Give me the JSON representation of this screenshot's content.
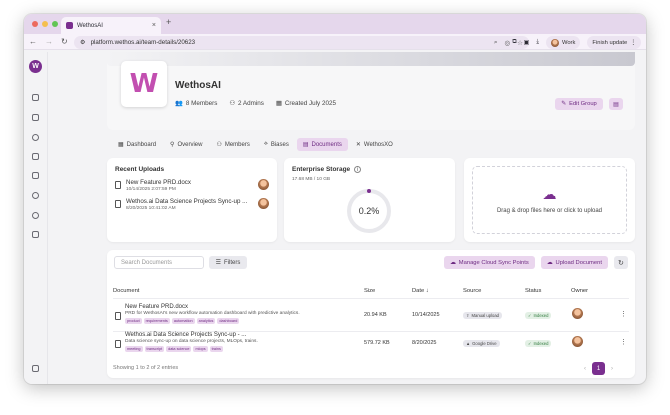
{
  "browser": {
    "tab_title": "WethosAI",
    "tab_close": "×",
    "new_tab": "+",
    "url": "platform.wethos.ai/team-details/20623",
    "profile_label": "Work",
    "update_label": "Finish update"
  },
  "org": {
    "name": "WethosAI",
    "members": "8 Members",
    "admins": "2 Admins",
    "created": "Created July 2025",
    "edit_label": "Edit Group",
    "logo_letter": "W"
  },
  "tabs": [
    {
      "label": "Dashboard"
    },
    {
      "label": "Overview"
    },
    {
      "label": "Members"
    },
    {
      "label": "Biases"
    },
    {
      "label": "Documents"
    },
    {
      "label": "WethosXO"
    }
  ],
  "recent_uploads": {
    "title": "Recent Uploads",
    "items": [
      {
        "name": "New Feature PRD.docx",
        "date": "10/14/2025 2:07:59 PM"
      },
      {
        "name": "Wethos.ai Data Science Projects Sync-up ...",
        "date": "8/20/2025 10:41:02 AM"
      }
    ]
  },
  "storage": {
    "title": "Enterprise Storage",
    "used": "17.68 MB / 10 GB",
    "percent_label": "0.2%",
    "percent_value": 0.2
  },
  "dropzone": {
    "text": "Drag & drop files here or click to upload"
  },
  "docs_toolbar": {
    "search_placeholder": "Search Documents",
    "filters_label": "Filters",
    "cloud_sync_label": "Manage Cloud Sync Points",
    "upload_label": "Upload Document"
  },
  "table": {
    "headers": {
      "document": "Document",
      "size": "Size",
      "date": "Date ↓",
      "source": "Source",
      "status": "Status",
      "owner": "Owner"
    },
    "rows": [
      {
        "name": "New Feature PRD.docx",
        "desc": "PRD for WethosAI's new workflow automation dashboard with predictive analytics.",
        "tags": [
          "product",
          "requirements",
          "automation",
          "analytics",
          "dashboard"
        ],
        "size": "20.94 KB",
        "date": "10/14/2025",
        "source": "Manual upload",
        "status": "Indexed"
      },
      {
        "name": "Wethos.ai Data Science Projects Sync-up - ...",
        "desc": "Data science sync-up on data science projects, MLOps, trains.",
        "tags": [
          "meeting",
          "transcript",
          "data science",
          "mlops",
          "trains"
        ],
        "size": "579.72 KB",
        "date": "8/20/2025",
        "source": "Google Drive",
        "status": "Indexed"
      }
    ],
    "footer": "Showing 1 to 2 of 2 entries",
    "page": "1"
  },
  "colors": {
    "accent": "#7a2f8f",
    "accent_light": "#ead6ee",
    "indexed": "#2f7a3c"
  }
}
